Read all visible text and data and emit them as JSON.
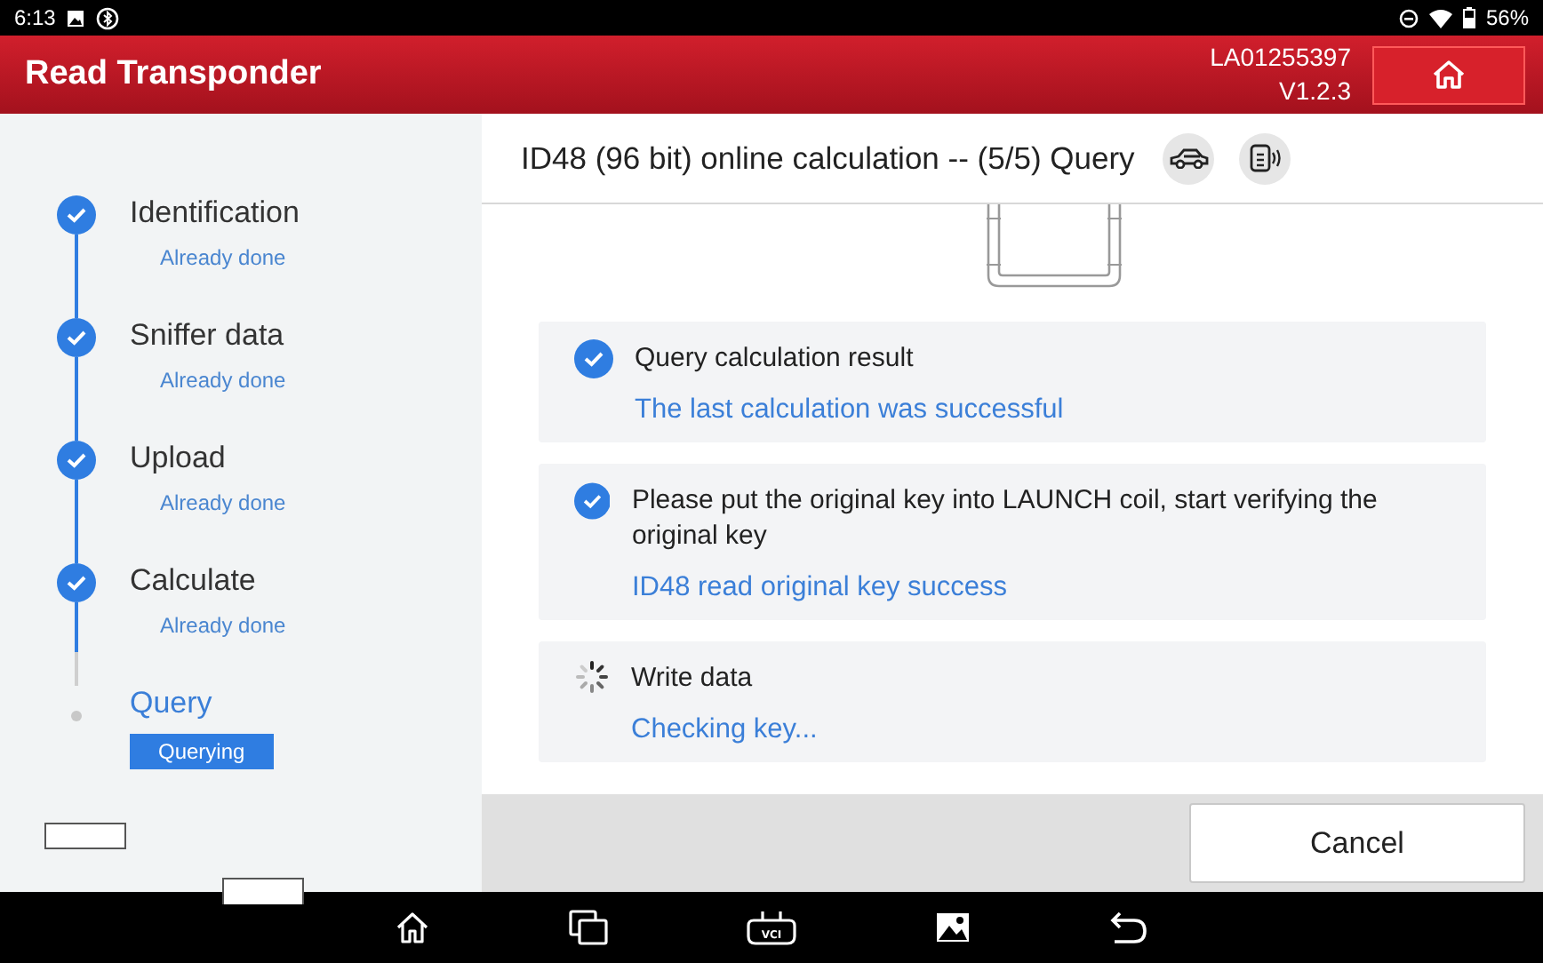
{
  "status_bar": {
    "time": "6:13",
    "battery": "56%"
  },
  "header": {
    "title": "Read Transponder",
    "serial": "LA01255397",
    "version": "V1.2.3"
  },
  "steps": [
    {
      "label": "Identification",
      "status": "Already done",
      "kind": "done"
    },
    {
      "label": "Sniffer data",
      "status": "Already done",
      "kind": "done"
    },
    {
      "label": "Upload",
      "status": "Already done",
      "kind": "done"
    },
    {
      "label": "Calculate",
      "status": "Already done",
      "kind": "done"
    },
    {
      "label": "Query",
      "status": "Querying",
      "kind": "current"
    }
  ],
  "main": {
    "title": "ID48 (96 bit) online calculation -- (5/5) Query"
  },
  "tasks": [
    {
      "kind": "done",
      "title": "Query calculation result",
      "result": "The last calculation was successful"
    },
    {
      "kind": "done",
      "title": "Please put the original key into LAUNCH coil, start verifying the original key",
      "result": "ID48 read original key success"
    },
    {
      "kind": "loading",
      "title": "Write data",
      "result": "Checking key..."
    }
  ],
  "cancel_button": "Cancel",
  "nav_bar": {
    "vci_label": "VCI"
  }
}
